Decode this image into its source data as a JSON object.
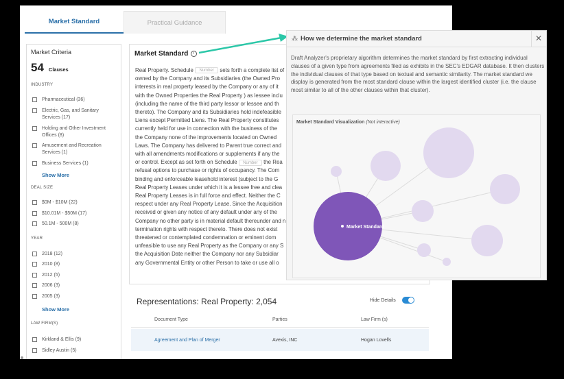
{
  "tabs": [
    "Market Standard",
    "Practical Guidance"
  ],
  "criteria": {
    "title": "Market Criteria",
    "count": "54",
    "count_label": "Clauses",
    "sections": {
      "industry": "INDUSTRY",
      "deal_size": "DEAL SIZE",
      "year": "YEAR",
      "law_firm": "LAW FIRM(S)"
    },
    "industry": [
      "Pharmaceutical (36)",
      "Electric, Gas, and Sanitary Services (17)",
      "Holding and Other Investment Offices (8)",
      "Amusement and Recreation Services (1)",
      "Business Services (1)"
    ],
    "deal_size": [
      "$0M - $10M (22)",
      "$10.01M - $50M (17)",
      "50.1M - 500M (8)"
    ],
    "year": [
      "2018 (12)",
      "2010 (8)",
      "2012 (5)",
      "2006 (3)",
      "2005 (3)"
    ],
    "law_firm": [
      "Kirkland & Ellis (9)",
      "Sidley Austin (5)"
    ],
    "show_more": "Show More"
  },
  "market_standard": {
    "title": "Market Standard",
    "info_icon": "i",
    "chip": "Number",
    "lines": [
      [
        "Real Property. Schedule ",
        "CHIP",
        " sets forth a complete list of"
      ],
      [
        "owned by the Company and its Subsidiaries (the Owned Pro"
      ],
      [
        "interests in real property leased by the Company or any of it"
      ],
      [
        "with the Owned Properties the Real Property ) as lessee inclu"
      ],
      [
        "(including the name of the third party lessor or lessee and th"
      ],
      [
        "thereto). The Company and its Subsidiaries hold indefeasible"
      ],
      [
        "Liens except Permitted Liens. The Real Property constitutes"
      ],
      [
        "currently held for use in connection with the business of the"
      ],
      [
        "the Company none of the improvements located on Owned"
      ],
      [
        "Laws. The Company has delivered to Parent true correct and"
      ],
      [
        "with all amendments modifications or supplements if any the"
      ],
      [
        "or control. Except as set forth on Schedule ",
        "CHIP",
        " the Rea"
      ],
      [
        "refusal options to purchase or rights of occupancy. The Com"
      ],
      [
        "binding and enforceable leasehold interest (subject to the G"
      ],
      [
        "Real Property Leases under which it is a lessee free and clea"
      ],
      [
        "Real Property Leases is in full force and effect. Neither the C"
      ],
      [
        "respect under any Real Property Lease. Since the Acquisition"
      ],
      [
        "received or given any notice of any default under any of the"
      ],
      [
        "Company no other party is in material default thereunder and n"
      ],
      [
        "termination rights with respect thereto. There does not exist"
      ],
      [
        "threatened or contemplated condemnation or eminent dom"
      ],
      [
        "unfeasible to use any Real Property as the Company or any S"
      ],
      [
        "the Acquisition Date neither the Company nor any Subsidiar"
      ],
      [
        "any Governmental Entity or other Person to take or use all o"
      ]
    ]
  },
  "representations": {
    "title": "Representations: Real Property: 2,054",
    "hide_details": "Hide Details",
    "columns": [
      "Document Type",
      "Parties",
      "Law Firm (s)"
    ],
    "rows": [
      [
        "Agreement and Plan of Merger",
        "Avexis, INC",
        "Hogan Lovells"
      ]
    ]
  },
  "popup": {
    "title": "How we determine the market standard",
    "icon": "bubbles-icon",
    "close": "✕",
    "body": "Draft Analyzer's proprietary algorithm determines the market standard by first extracting individual clauses of a given type from agreements filed as exhibits in the SEC's EDGAR database. It then clusters the individual clauses of that type based on textual and semantic similarity. The market standard we display is generated from the most standard clause within the largest identified cluster (i.e. the clause most similar to all of the other clauses within that cluster).",
    "viz_title": "Market Standard Visualization",
    "viz_note": "(Not interactive)",
    "main_label": "Market Standard"
  },
  "colors": {
    "accent": "#2a6fa8",
    "main_bubble": "#7f56b8",
    "bubble": "#e2d9ef",
    "arrow": "#2cc7a8"
  }
}
